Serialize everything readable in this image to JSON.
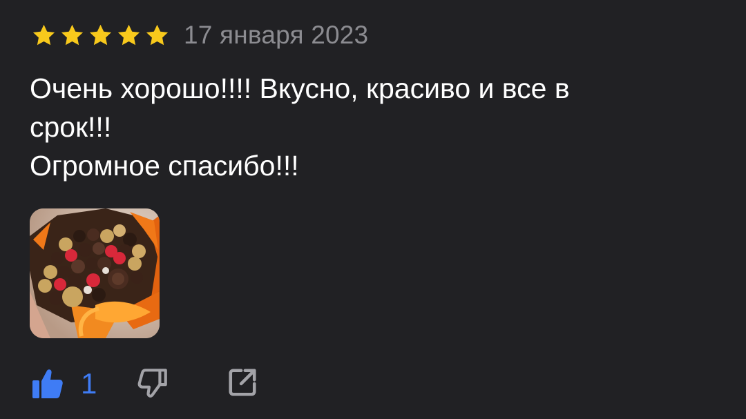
{
  "review": {
    "rating": 5,
    "max_rating": 5,
    "date": "17 января 2023",
    "text_lines": [
      "Очень хорошо!!!! Вкусно, красиво и все в",
      "срок!!!",
      "Огромное спасибо!!!"
    ],
    "likes": "1"
  },
  "colors": {
    "background": "#212124",
    "star": "#f8c91c",
    "date": "#8c8c91",
    "like_accent": "#3f7cf5",
    "icon_muted": "#a3a3a8"
  },
  "icons": {
    "star": "star-icon",
    "like": "thumbs-up-icon",
    "dislike": "thumbs-down-icon",
    "share": "share-icon"
  }
}
